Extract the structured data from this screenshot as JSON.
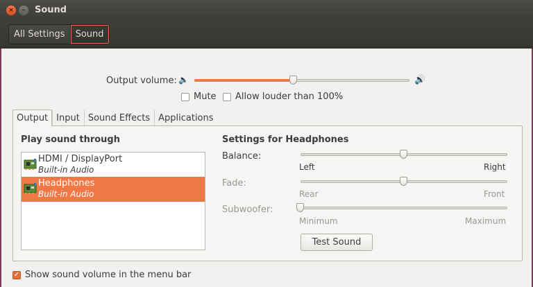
{
  "window": {
    "title": "Sound",
    "close_glyph": "×",
    "minimize_glyph": "–"
  },
  "toolbar": {
    "breadcrumbs": [
      "All Settings",
      "Sound"
    ]
  },
  "output_volume": {
    "label": "Output volume:",
    "level_percent": 46,
    "mute_label": "Mute",
    "mute_checked": false,
    "louder_label": "Allow louder than 100%",
    "louder_checked": false
  },
  "tabs": [
    "Output",
    "Input",
    "Sound Effects",
    "Applications"
  ],
  "output": {
    "devices_heading": "Play sound through",
    "devices": [
      {
        "name": "HDMI / DisplayPort",
        "sub": "Built-in Audio",
        "selected": false
      },
      {
        "name": "Headphones",
        "sub": "Built-in Audio",
        "selected": true
      }
    ],
    "settings_heading": "Settings for Headphones",
    "balance": {
      "label": "Balance:",
      "left": "Left",
      "right": "Right",
      "position_percent": 50
    },
    "fade": {
      "label": "Fade:",
      "left": "Rear",
      "right": "Front",
      "position_percent": 50
    },
    "subwoofer": {
      "label": "Subwoofer:",
      "left": "Minimum",
      "right": "Maximum",
      "position_percent": 0
    },
    "test_button": "Test Sound"
  },
  "menu_bar_option": {
    "label": "Show sound volume in the menu bar",
    "checked": true
  },
  "colors": {
    "accent": "#f07746",
    "titlebar": "#3d3c38"
  }
}
